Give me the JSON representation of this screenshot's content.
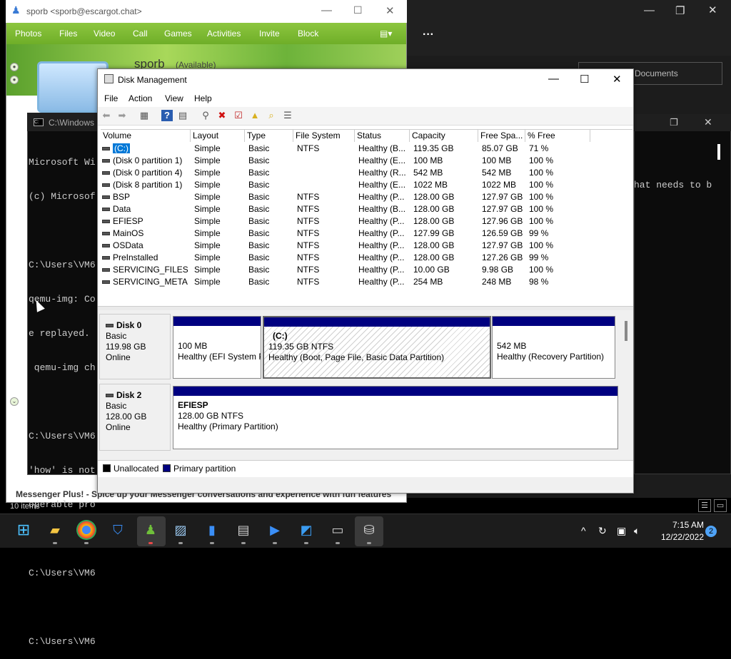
{
  "background": {
    "documents_label": "Documents",
    "terminal_text": "hat needs to b"
  },
  "messenger": {
    "title": "sporb <sporb@escargot.chat>",
    "menu": [
      "Photos",
      "Files",
      "Video",
      "Call",
      "Games",
      "Activities",
      "Invite",
      "Block"
    ],
    "display_name": "sporb",
    "status": "(Available)",
    "footer": "Messenger Plus! - Spice up your Messenger conversations and experience with fun features",
    "items_count": "10 items"
  },
  "cmd": {
    "title": "C:\\Windows",
    "lines": [
      "Microsoft Wi",
      "(c) Microsof",
      "",
      "C:\\Users\\VM6",
      "qemu-img: Co",
      "e replayed.",
      " qemu-img ch",
      "",
      "C:\\Users\\VM6",
      "'how' is not",
      "operable pro",
      "",
      "C:\\Users\\VM6",
      "",
      "C:\\Users\\VM6"
    ]
  },
  "disk_mgmt": {
    "title": "Disk Management",
    "menu": [
      "File",
      "Action",
      "View",
      "Help"
    ],
    "columns": [
      "Volume",
      "Layout",
      "Type",
      "File System",
      "Status",
      "Capacity",
      "Free Spa...",
      "% Free"
    ],
    "volumes": [
      {
        "volume": "(C:)",
        "layout": "Simple",
        "type": "Basic",
        "fs": "NTFS",
        "status": "Healthy (B...",
        "capacity": "119.35 GB",
        "free": "85.07 GB",
        "pct": "71 %"
      },
      {
        "volume": "(Disk 0 partition 1)",
        "layout": "Simple",
        "type": "Basic",
        "fs": "",
        "status": "Healthy (E...",
        "capacity": "100 MB",
        "free": "100 MB",
        "pct": "100 %"
      },
      {
        "volume": "(Disk 0 partition 4)",
        "layout": "Simple",
        "type": "Basic",
        "fs": "",
        "status": "Healthy (R...",
        "capacity": "542 MB",
        "free": "542 MB",
        "pct": "100 %"
      },
      {
        "volume": "(Disk 8 partition 1)",
        "layout": "Simple",
        "type": "Basic",
        "fs": "",
        "status": "Healthy (E...",
        "capacity": "1022 MB",
        "free": "1022 MB",
        "pct": "100 %"
      },
      {
        "volume": "BSP",
        "layout": "Simple",
        "type": "Basic",
        "fs": "NTFS",
        "status": "Healthy (P...",
        "capacity": "128.00 GB",
        "free": "127.97 GB",
        "pct": "100 %"
      },
      {
        "volume": "Data",
        "layout": "Simple",
        "type": "Basic",
        "fs": "NTFS",
        "status": "Healthy (B...",
        "capacity": "128.00 GB",
        "free": "127.97 GB",
        "pct": "100 %"
      },
      {
        "volume": "EFIESP",
        "layout": "Simple",
        "type": "Basic",
        "fs": "NTFS",
        "status": "Healthy (P...",
        "capacity": "128.00 GB",
        "free": "127.96 GB",
        "pct": "100 %"
      },
      {
        "volume": "MainOS",
        "layout": "Simple",
        "type": "Basic",
        "fs": "NTFS",
        "status": "Healthy (P...",
        "capacity": "127.99 GB",
        "free": "126.59 GB",
        "pct": "99 %"
      },
      {
        "volume": "OSData",
        "layout": "Simple",
        "type": "Basic",
        "fs": "NTFS",
        "status": "Healthy (P...",
        "capacity": "128.00 GB",
        "free": "127.97 GB",
        "pct": "100 %"
      },
      {
        "volume": "PreInstalled",
        "layout": "Simple",
        "type": "Basic",
        "fs": "NTFS",
        "status": "Healthy (P...",
        "capacity": "128.00 GB",
        "free": "127.26 GB",
        "pct": "99 %"
      },
      {
        "volume": "SERVICING_FILES",
        "layout": "Simple",
        "type": "Basic",
        "fs": "NTFS",
        "status": "Healthy (P...",
        "capacity": "10.00 GB",
        "free": "9.98 GB",
        "pct": "100 %"
      },
      {
        "volume": "SERVICING_META...",
        "layout": "Simple",
        "type": "Basic",
        "fs": "NTFS",
        "status": "Healthy (P...",
        "capacity": "254 MB",
        "free": "248 MB",
        "pct": "98 %"
      }
    ],
    "disks": [
      {
        "name": "Disk 0",
        "type": "Basic",
        "size": "119.98 GB",
        "state": "Online",
        "partitions": [
          {
            "label": "",
            "size": "100 MB",
            "status": "Healthy (EFI System Partition)"
          },
          {
            "label": "(C:)",
            "size": "119.35 GB NTFS",
            "status": "Healthy (Boot, Page File, Basic Data Partition)"
          },
          {
            "label": "",
            "size": "542 MB",
            "status": "Healthy (Recovery Partition)"
          }
        ]
      },
      {
        "name": "Disk 2",
        "type": "Basic",
        "size": "128.00 GB",
        "state": "Online",
        "partitions": [
          {
            "label": "EFIESP",
            "size": "128.00 GB NTFS",
            "status": "Healthy (Primary Partition)"
          }
        ]
      }
    ],
    "legend": [
      {
        "label": "Unallocated",
        "color": "#000000"
      },
      {
        "label": "Primary partition",
        "color": "#000080"
      }
    ]
  },
  "taskbar": {
    "time": "7:15 AM",
    "date": "12/22/2022",
    "notifications": "2"
  },
  "colors": {
    "primary_partition": "#000080",
    "selection": "#0078d7",
    "messenger_green": "#7ab534"
  }
}
